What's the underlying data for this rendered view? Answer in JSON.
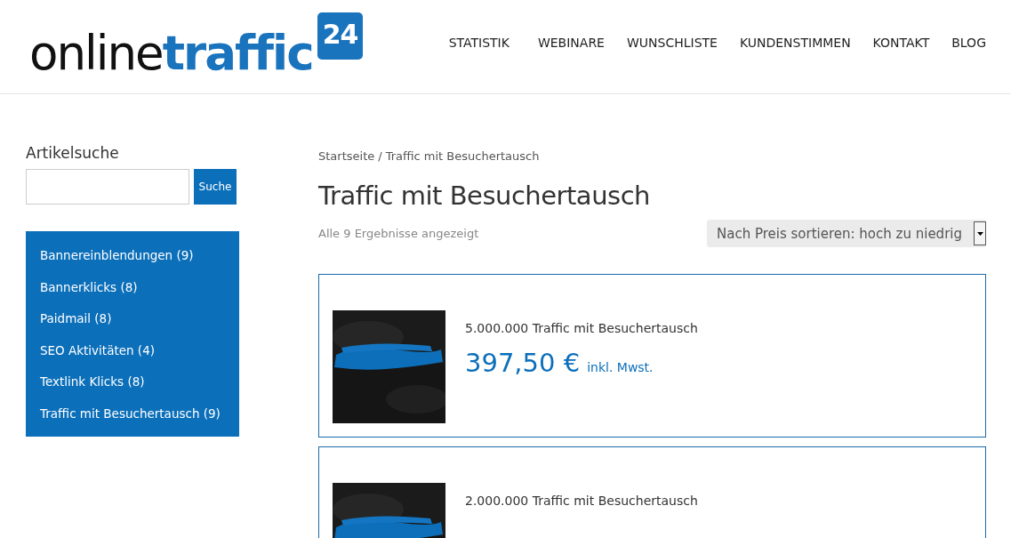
{
  "logo": {
    "text_dark": "online",
    "text_accent": "traffic",
    "badge": "24"
  },
  "nav": [
    {
      "label": "STATISTIK"
    },
    {
      "label": "WEBINARE"
    },
    {
      "label": "WUNSCHLISTE"
    },
    {
      "label": "KUNDENSTIMMEN"
    },
    {
      "label": "KONTAKT"
    },
    {
      "label": "BLOG"
    }
  ],
  "sidebar": {
    "search_title": "Artikelsuche",
    "search_button": "Suche",
    "categories": [
      {
        "label": "Bannereinblendungen (9)"
      },
      {
        "label": "Bannerklicks (8)"
      },
      {
        "label": "Paidmail (8)"
      },
      {
        "label": "SEO Aktivitäten (4)"
      },
      {
        "label": "Textlink Klicks (8)"
      },
      {
        "label": "Traffic mit Besuchertausch (9)"
      }
    ]
  },
  "breadcrumb": {
    "home": "Startseite",
    "separator": "/",
    "current": "Traffic mit Besuchertausch"
  },
  "title": "Traffic mit Besuchertausch",
  "result_count": "Alle 9 Ergebnisse angezeigt",
  "sort": {
    "value": "Nach Preis sortieren: hoch zu niedrig"
  },
  "products": [
    {
      "name": "5.000.000 Traffic mit Besuchertausch",
      "price": "397,50 €",
      "tax_note": "inkl. Mwst."
    },
    {
      "name": "2.000.000 Traffic mit Besuchertausch"
    }
  ]
}
